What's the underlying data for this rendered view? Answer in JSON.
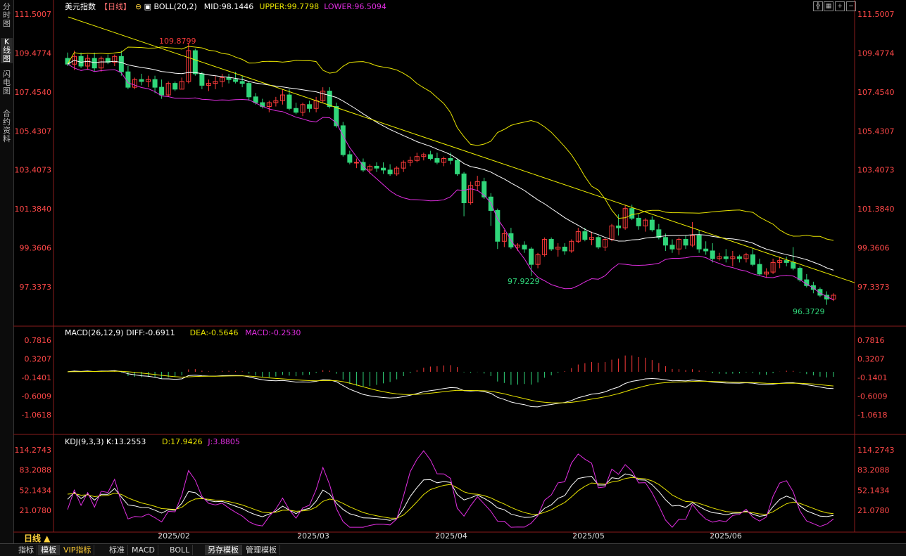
{
  "side_tabs": [
    "分时图",
    "K线图",
    "闪电图",
    "合约资料"
  ],
  "legend": {
    "instrument": "美元指数",
    "period": "【日线】",
    "boll_name": "BOLL(20,2)",
    "mid": "MID:98.1446",
    "upper": "UPPER:99.7798",
    "lower": "LOWER:96.5094"
  },
  "macd_legend": {
    "name": "MACD(26,12,9)",
    "diff": "DIFF:-0.6911",
    "dea": "DEA:-0.5646",
    "macd": "MACD:-0.2530"
  },
  "kdj_legend": {
    "name": "KDJ(9,3,3)",
    "k": "K:13.2553",
    "d": "D:17.9426",
    "j": "J:3.8805"
  },
  "price_axis": [
    "111.5007",
    "109.4774",
    "107.4540",
    "105.4307",
    "103.4073",
    "101.3840",
    "99.3606",
    "97.3373"
  ],
  "macd_axis": [
    "0.7816",
    "0.3207",
    "-0.1401",
    "-0.6009",
    "-1.0618"
  ],
  "kdj_axis": [
    "114.2743",
    "83.2088",
    "52.1434",
    "21.0780"
  ],
  "annotations": {
    "high": "109.8799",
    "low_mid": "97.9229",
    "low_end": "96.3729"
  },
  "date_labels": [
    "2025/02",
    "2025/03",
    "2025/04",
    "2025/05",
    "2025/06"
  ],
  "period_label": "日线 ▲",
  "bottom_tabs": [
    "指标",
    "模板",
    "VIP指标",
    "标准",
    "MACD",
    "BOLL",
    "另存模板",
    "管理模板"
  ],
  "colors": {
    "up": "#ff3b3b",
    "down": "#30d67a",
    "upper": "#e8e400",
    "mid": "#ffffff",
    "lower": "#e22ee2",
    "trend": "#f0f000",
    "axis": "#ff4848"
  },
  "chart_data": {
    "type": "candlestick",
    "series": [
      {
        "name": "美元指数 日线",
        "ohlc": [
          [
            109.2,
            109.5,
            108.8,
            108.9
          ],
          [
            108.9,
            109.6,
            108.6,
            109.3
          ],
          [
            109.3,
            109.5,
            108.7,
            108.8
          ],
          [
            108.8,
            109.4,
            108.6,
            109.2
          ],
          [
            109.2,
            109.5,
            108.5,
            108.7
          ],
          [
            108.7,
            109.3,
            108.5,
            109.2
          ],
          [
            109.2,
            109.4,
            108.9,
            109.0
          ],
          [
            109.0,
            109.4,
            108.8,
            109.3
          ],
          [
            109.3,
            109.6,
            108.3,
            108.5
          ],
          [
            108.5,
            108.8,
            107.6,
            107.7
          ],
          [
            107.7,
            108.2,
            107.6,
            108.1
          ],
          [
            108.1,
            108.4,
            107.8,
            108.0
          ],
          [
            108.0,
            108.3,
            107.7,
            108.1
          ],
          [
            108.1,
            108.3,
            107.4,
            107.7
          ],
          [
            107.7,
            108.1,
            107.1,
            107.3
          ],
          [
            107.3,
            108.0,
            107.2,
            107.9
          ],
          [
            107.9,
            108.0,
            107.5,
            107.6
          ],
          [
            107.6,
            108.2,
            107.6,
            108.0
          ],
          [
            108.0,
            110.0,
            107.9,
            109.6
          ],
          [
            109.6,
            109.7,
            108.3,
            108.4
          ],
          [
            108.4,
            108.5,
            107.6,
            107.8
          ],
          [
            107.8,
            108.1,
            107.5,
            107.9
          ],
          [
            107.9,
            108.3,
            107.6,
            108.0
          ],
          [
            108.0,
            108.4,
            107.7,
            108.2
          ],
          [
            108.2,
            108.4,
            107.9,
            108.1
          ],
          [
            108.1,
            108.5,
            107.9,
            108.0
          ],
          [
            108.0,
            108.3,
            107.7,
            107.9
          ],
          [
            107.9,
            108.0,
            107.0,
            107.2
          ],
          [
            107.2,
            107.4,
            106.8,
            106.9
          ],
          [
            106.9,
            107.1,
            106.6,
            106.7
          ],
          [
            106.7,
            107.0,
            106.4,
            106.9
          ],
          [
            106.9,
            107.2,
            106.7,
            107.0
          ],
          [
            107.0,
            107.6,
            106.8,
            107.3
          ],
          [
            107.3,
            107.6,
            106.5,
            106.6
          ],
          [
            106.6,
            106.9,
            106.3,
            106.4
          ],
          [
            106.4,
            106.9,
            106.2,
            106.8
          ],
          [
            106.8,
            107.0,
            106.4,
            106.6
          ],
          [
            106.6,
            107.2,
            106.4,
            107.0
          ],
          [
            107.0,
            107.7,
            106.9,
            107.5
          ],
          [
            107.5,
            107.7,
            106.6,
            106.7
          ],
          [
            106.7,
            106.9,
            105.6,
            105.7
          ],
          [
            105.7,
            105.9,
            104.1,
            104.2
          ],
          [
            104.2,
            104.4,
            103.7,
            103.8
          ],
          [
            103.8,
            104.0,
            103.5,
            103.8
          ],
          [
            103.8,
            104.0,
            103.3,
            103.4
          ],
          [
            103.4,
            103.7,
            103.2,
            103.6
          ],
          [
            103.6,
            103.8,
            103.3,
            103.5
          ],
          [
            103.5,
            103.8,
            103.2,
            103.4
          ],
          [
            103.4,
            103.7,
            103.1,
            103.2
          ],
          [
            103.2,
            103.6,
            103.1,
            103.5
          ],
          [
            103.5,
            103.9,
            103.3,
            103.8
          ],
          [
            103.8,
            104.1,
            103.6,
            103.9
          ],
          [
            103.9,
            104.3,
            103.8,
            104.1
          ],
          [
            104.1,
            104.3,
            103.9,
            104.2
          ],
          [
            104.2,
            104.4,
            103.9,
            104.0
          ],
          [
            104.0,
            104.3,
            103.7,
            103.8
          ],
          [
            103.8,
            104.1,
            103.6,
            104.0
          ],
          [
            104.0,
            104.3,
            103.7,
            103.9
          ],
          [
            103.9,
            104.0,
            103.1,
            103.2
          ],
          [
            103.2,
            103.3,
            101.0,
            101.7
          ],
          [
            101.7,
            102.8,
            101.6,
            102.6
          ],
          [
            102.6,
            103.1,
            102.3,
            102.8
          ],
          [
            102.8,
            103.0,
            101.9,
            102.0
          ],
          [
            102.0,
            102.2,
            100.5,
            101.3
          ],
          [
            101.3,
            101.4,
            99.3,
            99.7
          ],
          [
            99.7,
            100.3,
            99.4,
            100.1
          ],
          [
            100.1,
            100.4,
            99.3,
            99.4
          ],
          [
            99.4,
            99.6,
            99.2,
            99.5
          ],
          [
            99.5,
            99.7,
            99.1,
            99.3
          ],
          [
            99.3,
            99.4,
            97.9,
            98.5
          ],
          [
            98.5,
            99.1,
            98.3,
            99.0
          ],
          [
            99.0,
            99.9,
            98.9,
            99.8
          ],
          [
            99.8,
            99.9,
            99.2,
            99.3
          ],
          [
            99.3,
            99.6,
            98.9,
            99.4
          ],
          [
            99.4,
            99.6,
            99.0,
            99.2
          ],
          [
            99.2,
            99.8,
            99.1,
            99.7
          ],
          [
            99.7,
            100.4,
            99.6,
            100.2
          ],
          [
            100.2,
            100.4,
            99.7,
            99.8
          ],
          [
            99.8,
            100.2,
            99.5,
            99.9
          ],
          [
            99.9,
            100.0,
            99.3,
            99.4
          ],
          [
            99.4,
            99.9,
            99.2,
            99.8
          ],
          [
            99.8,
            100.6,
            99.7,
            100.5
          ],
          [
            100.5,
            101.1,
            100.0,
            100.4
          ],
          [
            100.4,
            101.6,
            100.3,
            101.4
          ],
          [
            101.4,
            101.6,
            100.8,
            100.9
          ],
          [
            100.9,
            101.1,
            100.3,
            100.5
          ],
          [
            100.5,
            100.9,
            100.2,
            100.8
          ],
          [
            100.8,
            101.0,
            100.2,
            100.3
          ],
          [
            100.3,
            100.6,
            99.8,
            99.9
          ],
          [
            99.9,
            100.1,
            99.2,
            99.5
          ],
          [
            99.5,
            99.8,
            99.1,
            99.3
          ],
          [
            99.3,
            99.9,
            99.0,
            99.8
          ],
          [
            99.8,
            100.0,
            99.3,
            99.5
          ],
          [
            99.5,
            100.7,
            99.4,
            100.0
          ],
          [
            100.0,
            100.3,
            99.1,
            99.3
          ],
          [
            99.3,
            99.7,
            99.0,
            99.2
          ],
          [
            99.2,
            99.6,
            98.6,
            98.8
          ],
          [
            98.8,
            99.1,
            98.7,
            98.9
          ],
          [
            98.9,
            99.3,
            98.6,
            98.8
          ],
          [
            98.8,
            99.2,
            98.4,
            98.9
          ],
          [
            98.9,
            99.0,
            98.6,
            98.8
          ],
          [
            98.8,
            99.1,
            98.6,
            99.0
          ],
          [
            99.0,
            99.3,
            98.4,
            98.5
          ],
          [
            98.5,
            98.8,
            97.9,
            98.0
          ],
          [
            98.0,
            98.3,
            97.8,
            98.1
          ],
          [
            98.1,
            98.8,
            98.0,
            98.6
          ],
          [
            98.6,
            98.9,
            98.3,
            98.7
          ],
          [
            98.7,
            98.9,
            98.4,
            98.6
          ],
          [
            98.6,
            99.4,
            98.2,
            98.3
          ],
          [
            98.3,
            98.4,
            97.6,
            97.7
          ],
          [
            97.7,
            98.0,
            97.3,
            97.4
          ],
          [
            97.4,
            97.6,
            97.0,
            97.2
          ],
          [
            97.2,
            97.3,
            96.8,
            96.9
          ],
          [
            96.9,
            97.1,
            96.4,
            96.7
          ],
          [
            96.7,
            97.0,
            96.6,
            96.9
          ]
        ]
      }
    ],
    "dates": [
      "2025/02",
      "2025/03",
      "2025/04",
      "2025/05",
      "2025/06"
    ],
    "boll": {
      "upper": 99.7798,
      "mid": 98.1446,
      "lower": 96.5094
    },
    "macd": {
      "diff": -0.6911,
      "dea": -0.5646,
      "macd": -0.253
    },
    "kdj": {
      "k": 13.2553,
      "d": 17.9426,
      "j": 3.8805
    },
    "ylim_price": [
      96.3,
      111.8
    ]
  }
}
